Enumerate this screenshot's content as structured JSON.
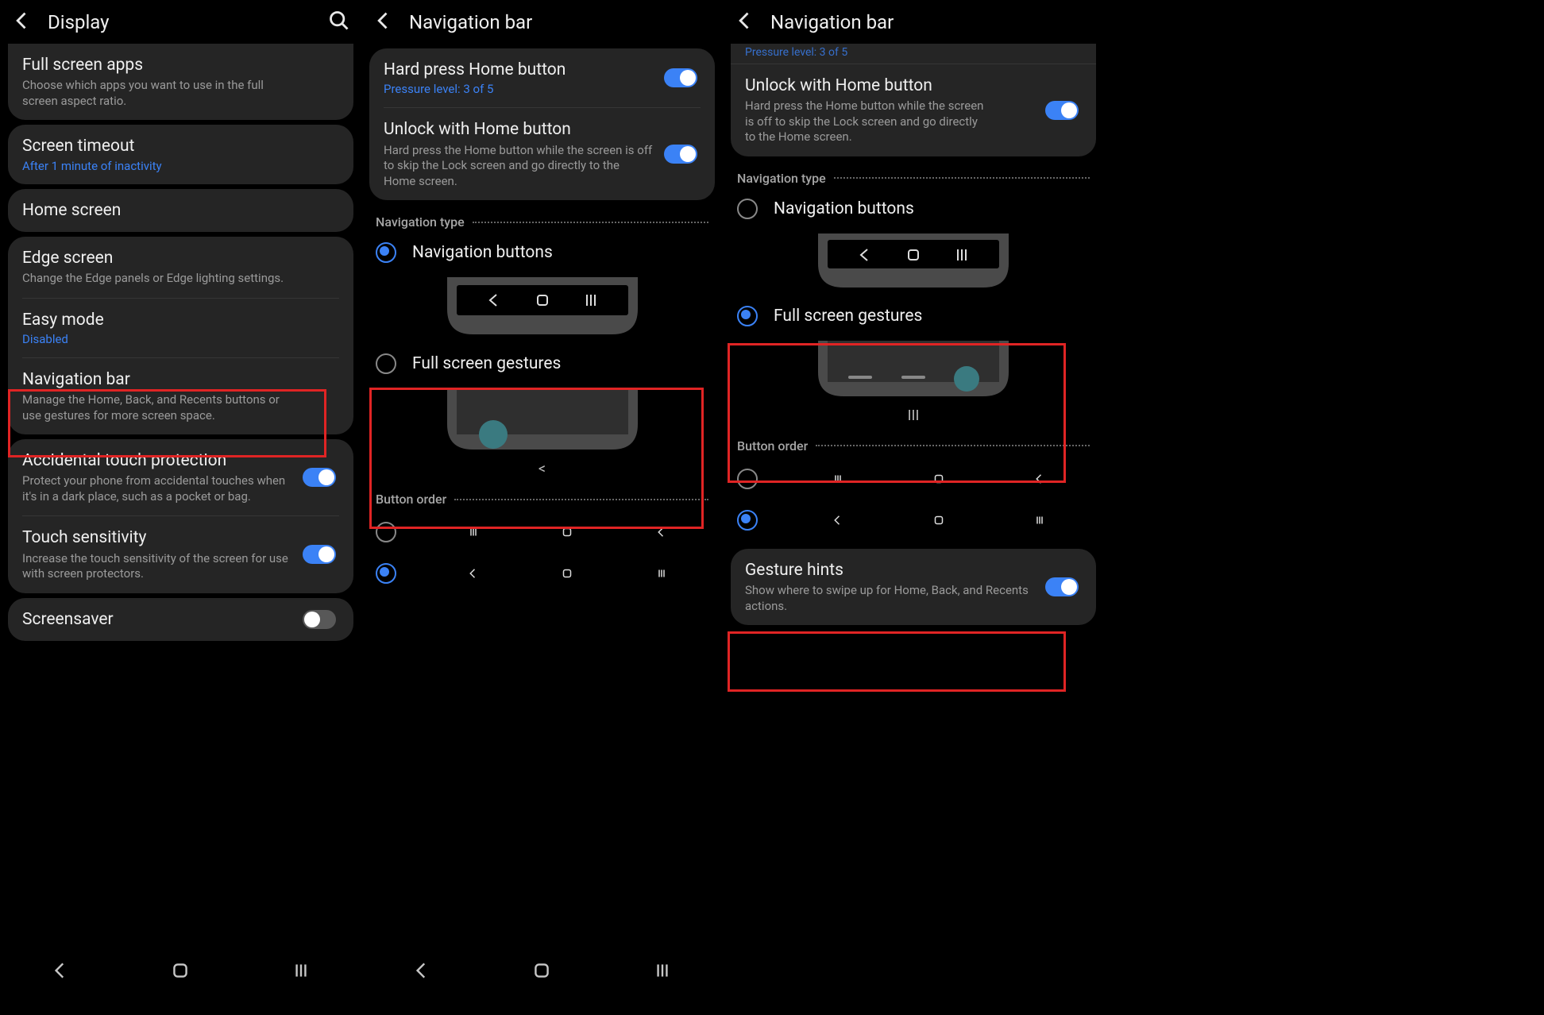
{
  "s1": {
    "title": "Display",
    "fullscreen_title": "Full screen apps",
    "fullscreen_sub": "Choose which apps you want to use in the full screen aspect ratio.",
    "timeout_title": "Screen timeout",
    "timeout_link": "After 1 minute of inactivity",
    "home_title": "Home screen",
    "edge_title": "Edge screen",
    "edge_sub": "Change the Edge panels or Edge lighting settings.",
    "easy_title": "Easy mode",
    "easy_link": "Disabled",
    "nav_title": "Navigation bar",
    "nav_sub": "Manage the Home, Back, and Recents buttons or use gestures for more screen space.",
    "atp_title": "Accidental touch protection",
    "atp_sub": "Protect your phone from accidental touches when it's in a dark place, such as a pocket or bag.",
    "ts_title": "Touch sensitivity",
    "ts_sub": "Increase the touch sensitivity of the screen for use with screen protectors.",
    "ss_title": "Screensaver"
  },
  "s2": {
    "title": "Navigation bar",
    "hard_title": "Hard press Home button",
    "hard_link": "Pressure level: 3 of 5",
    "unlock_title": "Unlock with Home button",
    "unlock_sub": "Hard press the Home button while the screen is off to skip the Lock screen and go directly to the Home screen.",
    "navtype_hdr": "Navigation type",
    "opt_buttons": "Navigation buttons",
    "opt_gestures": "Full screen gestures",
    "gest_caption": "<",
    "order_hdr": "Button order"
  },
  "s3": {
    "title": "Navigation bar",
    "cutoff": "Pressure level: 3 of 5",
    "unlock_title": "Unlock with Home button",
    "unlock_sub": "Hard press the Home button while the screen is off to skip the Lock screen and go directly to the Home screen.",
    "navtype_hdr": "Navigation type",
    "opt_buttons": "Navigation buttons",
    "opt_gestures": "Full screen gestures",
    "gest_caption": "III",
    "order_hdr": "Button order",
    "gh_title": "Gesture hints",
    "gh_sub": "Show where to swipe up for Home, Back, and Recents actions."
  }
}
